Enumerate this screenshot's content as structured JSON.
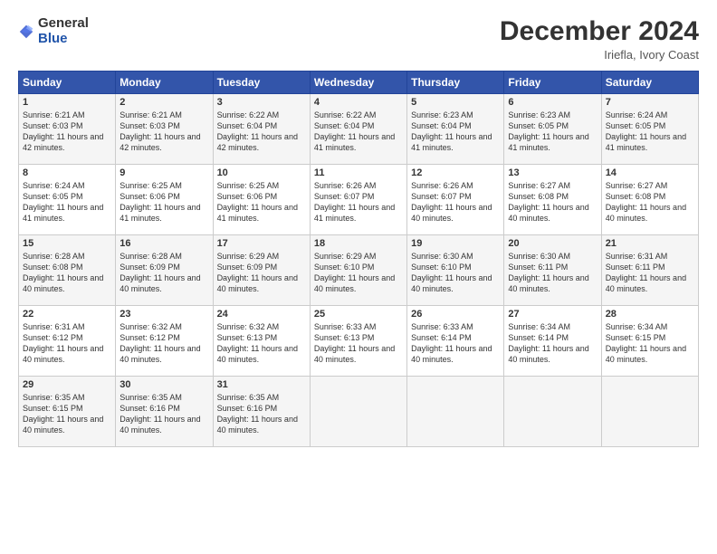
{
  "logo": {
    "general": "General",
    "blue": "Blue"
  },
  "header": {
    "title": "December 2024",
    "location": "Iriefla, Ivory Coast"
  },
  "days_of_week": [
    "Sunday",
    "Monday",
    "Tuesday",
    "Wednesday",
    "Thursday",
    "Friday",
    "Saturday"
  ],
  "weeks": [
    [
      {
        "day": "1",
        "sunrise": "6:21 AM",
        "sunset": "6:03 PM",
        "daylight": "11 hours and 42 minutes."
      },
      {
        "day": "2",
        "sunrise": "6:21 AM",
        "sunset": "6:03 PM",
        "daylight": "11 hours and 42 minutes."
      },
      {
        "day": "3",
        "sunrise": "6:22 AM",
        "sunset": "6:04 PM",
        "daylight": "11 hours and 42 minutes."
      },
      {
        "day": "4",
        "sunrise": "6:22 AM",
        "sunset": "6:04 PM",
        "daylight": "11 hours and 41 minutes."
      },
      {
        "day": "5",
        "sunrise": "6:23 AM",
        "sunset": "6:04 PM",
        "daylight": "11 hours and 41 minutes."
      },
      {
        "day": "6",
        "sunrise": "6:23 AM",
        "sunset": "6:05 PM",
        "daylight": "11 hours and 41 minutes."
      },
      {
        "day": "7",
        "sunrise": "6:24 AM",
        "sunset": "6:05 PM",
        "daylight": "11 hours and 41 minutes."
      }
    ],
    [
      {
        "day": "8",
        "sunrise": "6:24 AM",
        "sunset": "6:05 PM",
        "daylight": "11 hours and 41 minutes."
      },
      {
        "day": "9",
        "sunrise": "6:25 AM",
        "sunset": "6:06 PM",
        "daylight": "11 hours and 41 minutes."
      },
      {
        "day": "10",
        "sunrise": "6:25 AM",
        "sunset": "6:06 PM",
        "daylight": "11 hours and 41 minutes."
      },
      {
        "day": "11",
        "sunrise": "6:26 AM",
        "sunset": "6:07 PM",
        "daylight": "11 hours and 41 minutes."
      },
      {
        "day": "12",
        "sunrise": "6:26 AM",
        "sunset": "6:07 PM",
        "daylight": "11 hours and 40 minutes."
      },
      {
        "day": "13",
        "sunrise": "6:27 AM",
        "sunset": "6:08 PM",
        "daylight": "11 hours and 40 minutes."
      },
      {
        "day": "14",
        "sunrise": "6:27 AM",
        "sunset": "6:08 PM",
        "daylight": "11 hours and 40 minutes."
      }
    ],
    [
      {
        "day": "15",
        "sunrise": "6:28 AM",
        "sunset": "6:08 PM",
        "daylight": "11 hours and 40 minutes."
      },
      {
        "day": "16",
        "sunrise": "6:28 AM",
        "sunset": "6:09 PM",
        "daylight": "11 hours and 40 minutes."
      },
      {
        "day": "17",
        "sunrise": "6:29 AM",
        "sunset": "6:09 PM",
        "daylight": "11 hours and 40 minutes."
      },
      {
        "day": "18",
        "sunrise": "6:29 AM",
        "sunset": "6:10 PM",
        "daylight": "11 hours and 40 minutes."
      },
      {
        "day": "19",
        "sunrise": "6:30 AM",
        "sunset": "6:10 PM",
        "daylight": "11 hours and 40 minutes."
      },
      {
        "day": "20",
        "sunrise": "6:30 AM",
        "sunset": "6:11 PM",
        "daylight": "11 hours and 40 minutes."
      },
      {
        "day": "21",
        "sunrise": "6:31 AM",
        "sunset": "6:11 PM",
        "daylight": "11 hours and 40 minutes."
      }
    ],
    [
      {
        "day": "22",
        "sunrise": "6:31 AM",
        "sunset": "6:12 PM",
        "daylight": "11 hours and 40 minutes."
      },
      {
        "day": "23",
        "sunrise": "6:32 AM",
        "sunset": "6:12 PM",
        "daylight": "11 hours and 40 minutes."
      },
      {
        "day": "24",
        "sunrise": "6:32 AM",
        "sunset": "6:13 PM",
        "daylight": "11 hours and 40 minutes."
      },
      {
        "day": "25",
        "sunrise": "6:33 AM",
        "sunset": "6:13 PM",
        "daylight": "11 hours and 40 minutes."
      },
      {
        "day": "26",
        "sunrise": "6:33 AM",
        "sunset": "6:14 PM",
        "daylight": "11 hours and 40 minutes."
      },
      {
        "day": "27",
        "sunrise": "6:34 AM",
        "sunset": "6:14 PM",
        "daylight": "11 hours and 40 minutes."
      },
      {
        "day": "28",
        "sunrise": "6:34 AM",
        "sunset": "6:15 PM",
        "daylight": "11 hours and 40 minutes."
      }
    ],
    [
      {
        "day": "29",
        "sunrise": "6:35 AM",
        "sunset": "6:15 PM",
        "daylight": "11 hours and 40 minutes."
      },
      {
        "day": "30",
        "sunrise": "6:35 AM",
        "sunset": "6:16 PM",
        "daylight": "11 hours and 40 minutes."
      },
      {
        "day": "31",
        "sunrise": "6:35 AM",
        "sunset": "6:16 PM",
        "daylight": "11 hours and 40 minutes."
      },
      null,
      null,
      null,
      null
    ]
  ],
  "labels": {
    "sunrise_prefix": "Sunrise: ",
    "sunset_prefix": "Sunset: ",
    "daylight_prefix": "Daylight: "
  }
}
